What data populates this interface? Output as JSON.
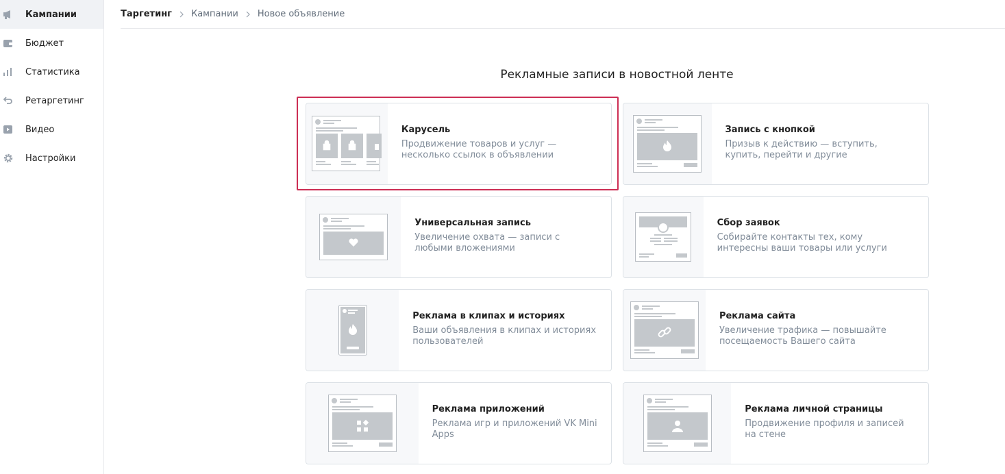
{
  "sidebar": {
    "items": [
      {
        "label": "Кампании",
        "icon": "megaphone-icon",
        "active": true
      },
      {
        "label": "Бюджет",
        "icon": "wallet-icon",
        "active": false
      },
      {
        "label": "Статистика",
        "icon": "bar-chart-icon",
        "active": false
      },
      {
        "label": "Ретаргетинг",
        "icon": "retarget-arrow-icon",
        "active": false
      },
      {
        "label": "Видео",
        "icon": "video-icon",
        "active": false
      },
      {
        "label": "Настройки",
        "icon": "gear-icon",
        "active": false
      }
    ]
  },
  "breadcrumb": {
    "root": "Таргетинг",
    "middle": "Кампании",
    "current": "Новое объявление"
  },
  "main": {
    "title": "Рекламные записи в новостной ленте",
    "cards": [
      {
        "title": "Карусель",
        "desc": "Продвижение товаров и услуг — несколько ссылок в объявлении",
        "illustration": "carousel-illustration-icon",
        "selected": true
      },
      {
        "title": "Запись с кнопкой",
        "desc": "Призыв к действию — вступить, купить, перейти и другие",
        "illustration": "button-post-illustration-icon"
      },
      {
        "title": "Универсальная запись",
        "desc": "Увеличение охвата — записи с любыми вложениями",
        "illustration": "universal-post-illustration-icon"
      },
      {
        "title": "Сбор заявок",
        "desc": "Собирайте контакты тех, кому интересны ваши товары или услуги",
        "illustration": "lead-form-illustration-icon"
      },
      {
        "title": "Реклама в клипах и историях",
        "desc": "Ваши объявления в клипах и историях пользователей",
        "illustration": "stories-illustration-icon"
      },
      {
        "title": "Реклама сайта",
        "desc": "Увеличение трафика — повышайте посещаемость Вашего сайта",
        "illustration": "website-illustration-icon"
      },
      {
        "title": "Реклама приложений",
        "desc": "Реклама игр и приложений VK Mini Apps",
        "illustration": "apps-illustration-icon"
      },
      {
        "title": "Реклама личной страницы",
        "desc": "Продвижение профиля и записей на стене",
        "illustration": "profile-illustration-icon"
      }
    ]
  },
  "colors": {
    "selection": "#cc2e54",
    "illustration_fill": "#c4c8cc",
    "card_border": "#dce1e6"
  }
}
